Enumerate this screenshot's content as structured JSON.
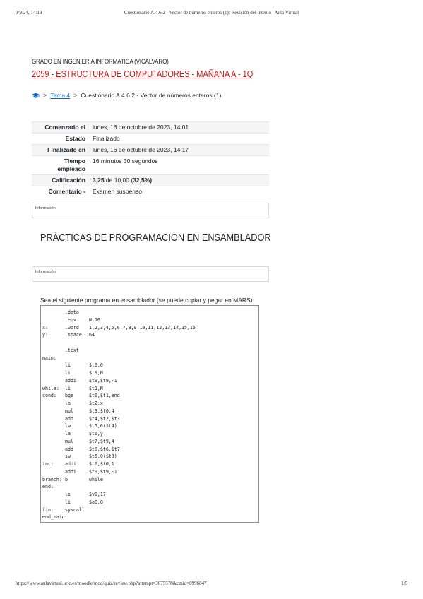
{
  "print_header": {
    "datetime": "9/9/24, 14:19",
    "doc_title": "Cuestionario A.4.6.2 - Vector de números enteros (1): Revisión del intento | Aula Virtual"
  },
  "degree": "GRADO EN INGENIERIA INFORMATICA (VICALVARO)",
  "course": "2059 - ESTRUCTURA DE COMPUTADORES - MAÑANA A - 1Q",
  "breadcrumb": {
    "home_icon": "mortarboard-icon",
    "separator": ">",
    "item1": "Tema 4",
    "item2": "Cuestionario A.4.6.2 - Vector de números enteros (1)"
  },
  "summary": [
    {
      "label": "Comenzado el",
      "value": "lunes, 16 de octubre de 2023, 14:01"
    },
    {
      "label": "Estado",
      "value": "Finalizado"
    },
    {
      "label": "Finalizado en",
      "value": "lunes, 16 de octubre de 2023, 14:17"
    },
    {
      "label": "Tiempo empleado",
      "value": "16 minutos 30 segundos"
    },
    {
      "label": "Calificación",
      "value_bold": "3,25",
      "value_rest": " de 10,00 (",
      "value_bold2": "32,5",
      "value_end": "%)"
    },
    {
      "label": "Comentario -",
      "value": "Examen suspenso"
    }
  ],
  "info_label_1": "Información",
  "section_title": "PRÁCTICAS DE PROGRAMACIÓN EN ENSAMBLADOR",
  "info_label_2": "Información",
  "question_text": "Sea el siguiente programa en ensamblador (se puede copiar y pegar en MARS):",
  "code_lines": [
    [
      "",
      ".data",
      ""
    ],
    [
      "",
      ".eqv",
      "N,16"
    ],
    [
      "x:",
      ".word",
      "1,2,3,4,5,6,7,8,9,10,11,12,13,14,15,16"
    ],
    [
      "y:",
      ".space",
      "64"
    ],
    [
      "",
      "",
      ""
    ],
    [
      "",
      ".text",
      ""
    ],
    [
      "main:",
      "",
      ""
    ],
    [
      "",
      "li",
      "$t0,0"
    ],
    [
      "",
      "li",
      "$t9,N"
    ],
    [
      "",
      "addi",
      "$t9,$t9,-1"
    ],
    [
      "while:",
      "li",
      "$t1,N"
    ],
    [
      "cond:",
      "bge",
      "$t0,$t1,end"
    ],
    [
      "",
      "la",
      "$t2,x"
    ],
    [
      "",
      "mul",
      "$t3,$t0,4"
    ],
    [
      "",
      "add",
      "$t4,$t2,$t3"
    ],
    [
      "",
      "lw",
      "$t5,0($t4)"
    ],
    [
      "",
      "la",
      "$t6,y"
    ],
    [
      "",
      "mul",
      "$t7,$t9,4"
    ],
    [
      "",
      "add",
      "$t8,$t6,$t7"
    ],
    [
      "",
      "sw",
      "$t5,0($t8)"
    ],
    [
      "inc:",
      "addi",
      "$t0,$t0,1"
    ],
    [
      "",
      "addi",
      "$t9,$t9,-1"
    ],
    [
      "branch:",
      "b",
      "while"
    ],
    [
      "end:",
      "",
      ""
    ],
    [
      "",
      "li",
      "$v0,17"
    ],
    [
      "",
      "li",
      "$a0,0"
    ],
    [
      "fin:",
      "syscall",
      ""
    ],
    [
      "end_main:",
      "",
      ""
    ]
  ],
  "print_footer": {
    "url": "https://www.aulavirtual.urjc.es/moodle/mod/quiz/review.php?attempt=3675578&cmid=8996847",
    "page": "1/5"
  }
}
